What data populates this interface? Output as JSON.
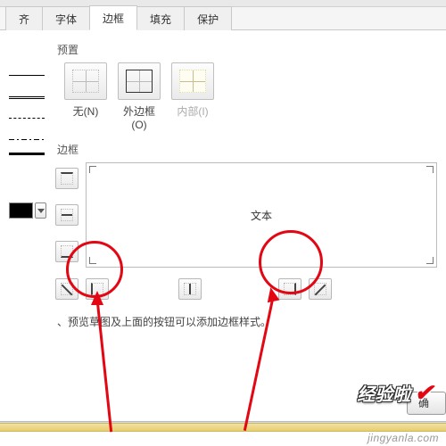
{
  "tabs": {
    "align": "齐",
    "font": "字体",
    "border": "边框",
    "fill": "填充",
    "protect": "保护"
  },
  "sections": {
    "preset": "预置",
    "border": "边框"
  },
  "presets": {
    "none": "无(N)",
    "outline": "外边框(O)",
    "inside": "内部(I)"
  },
  "preview": {
    "sample": "文本"
  },
  "hint": "、预览草图及上面的按钮可以添加边框样式。",
  "buttons": {
    "ok": "确"
  },
  "watermark": {
    "logo": "经验啦",
    "url": "jingyanla.com"
  },
  "colors": {
    "accent": "#e30613"
  }
}
